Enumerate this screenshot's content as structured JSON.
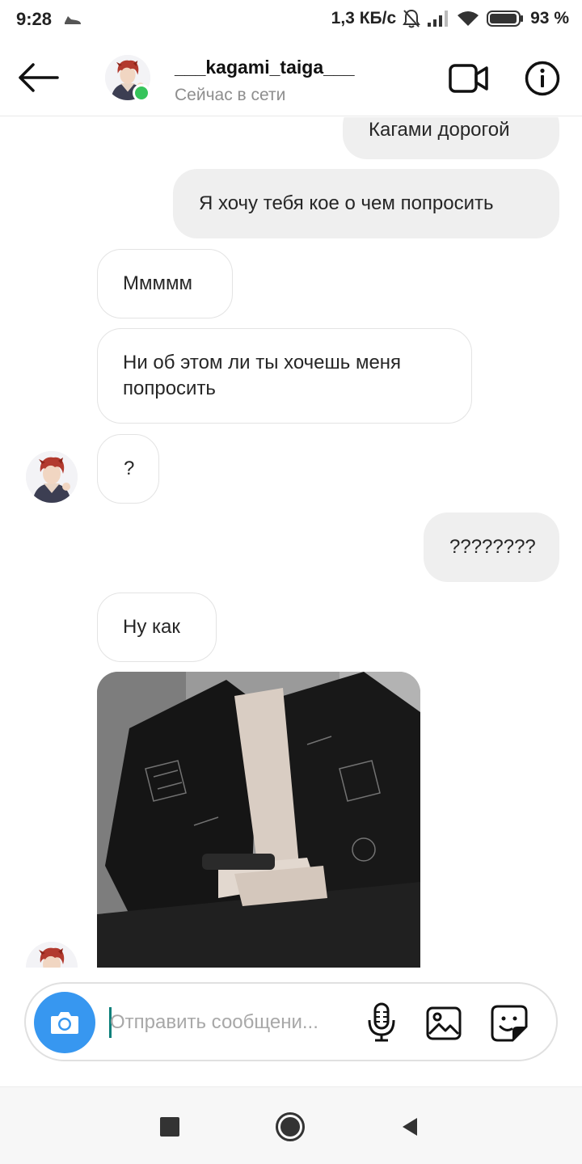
{
  "status_bar": {
    "time": "9:28",
    "network_speed": "1,3 КБ/с",
    "battery": "93 %"
  },
  "header": {
    "username": "___kagami_taiga___",
    "presence": "Сейчас в сети"
  },
  "messages": [
    {
      "direction": "outgoing",
      "text": "Кагами дорогой"
    },
    {
      "direction": "outgoing",
      "text": "Я хочу тебя кое о чем попросить"
    },
    {
      "direction": "incoming",
      "text": "Ммммм"
    },
    {
      "direction": "incoming",
      "text": "Ни об этом ли ты хочешь меня попросить"
    },
    {
      "direction": "incoming",
      "text": "?"
    },
    {
      "direction": "outgoing",
      "text": "????????"
    },
    {
      "direction": "incoming",
      "text": "Ну как"
    },
    {
      "direction": "incoming",
      "type": "photo"
    }
  ],
  "composer": {
    "placeholder": "Отправить сообщени..."
  },
  "colors": {
    "accent_blue": "#3797f0",
    "online_green": "#36c45b",
    "outgoing_bubble": "#efefef",
    "secondary_text": "#8e8e8e"
  },
  "icons": {
    "back": "arrow-left-icon",
    "video": "video-camera-icon",
    "info": "info-icon",
    "camera": "camera-icon",
    "mic": "microphone-icon",
    "gallery": "image-icon",
    "sticker": "sticker-icon"
  }
}
